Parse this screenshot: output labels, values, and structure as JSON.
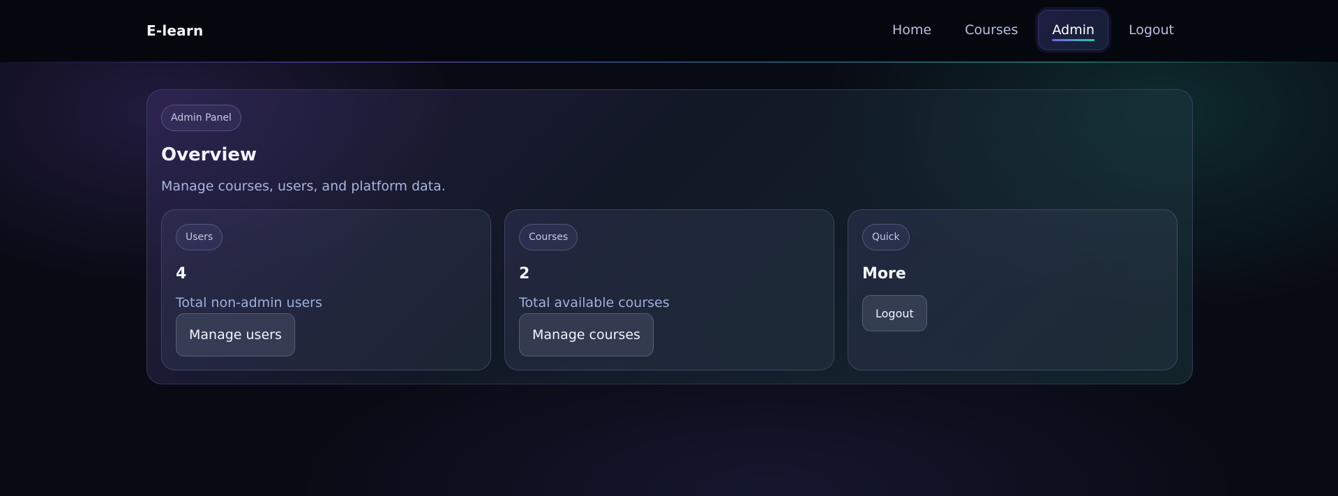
{
  "header": {
    "brand": "E-learn",
    "nav": [
      {
        "label": "Home",
        "active": false
      },
      {
        "label": "Courses",
        "active": false
      },
      {
        "label": "Admin",
        "active": true
      },
      {
        "label": "Logout",
        "active": false
      }
    ]
  },
  "panel": {
    "badge": "Admin Panel",
    "title": "Overview",
    "subtitle": "Manage courses, users, and platform data.",
    "cards": [
      {
        "badge": "Users",
        "value": "4",
        "description": "Total non-admin users",
        "button": "Manage users"
      },
      {
        "badge": "Courses",
        "value": "2",
        "description": "Total available courses",
        "button": "Manage courses"
      },
      {
        "badge": "Quick",
        "value": "More",
        "button": "Logout"
      }
    ]
  },
  "colors": {
    "background": "#090b14",
    "header": "#05070e",
    "accent_purple": "#7a63e8",
    "accent_teal": "#2fc8b0",
    "muted_text": "#aab6e0"
  }
}
